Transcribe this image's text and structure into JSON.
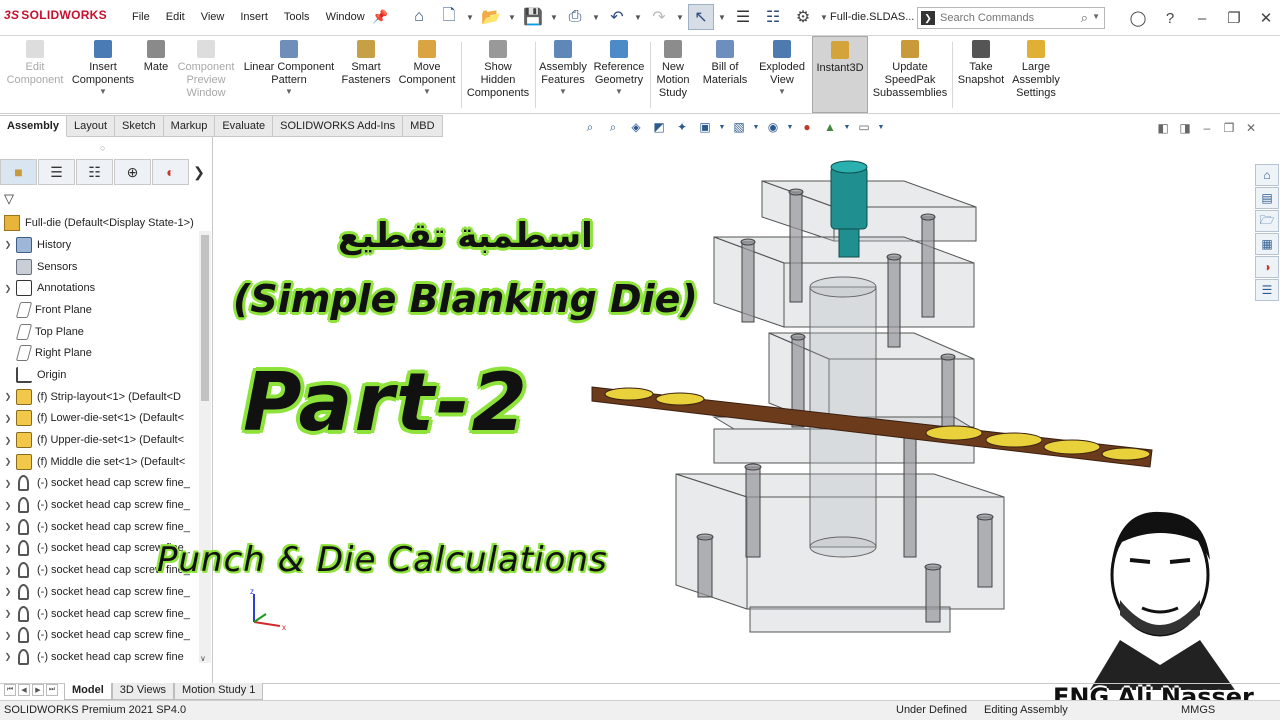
{
  "app": {
    "brand": "SOLIDWORKS",
    "document_title": "Full-die.SLDAS..."
  },
  "menu": [
    "File",
    "Edit",
    "View",
    "Insert",
    "Tools",
    "Window"
  ],
  "search": {
    "placeholder": "Search Commands"
  },
  "ribbon": [
    {
      "label": "Edit\nComponent",
      "enabled": false
    },
    {
      "label": "Insert\nComponents",
      "enabled": true,
      "dropdown": true
    },
    {
      "label": "Mate",
      "enabled": true
    },
    {
      "label": "Component\nPreview\nWindow",
      "enabled": false
    },
    {
      "label": "Linear Component\nPattern",
      "enabled": true,
      "dropdown": true
    },
    {
      "label": "Smart\nFasteners",
      "enabled": true
    },
    {
      "label": "Move\nComponent",
      "enabled": true,
      "dropdown": true
    },
    {
      "label": "Show\nHidden\nComponents",
      "enabled": true
    },
    {
      "label": "Assembly\nFeatures",
      "enabled": true,
      "dropdown": true
    },
    {
      "label": "Reference\nGeometry",
      "enabled": true,
      "dropdown": true
    },
    {
      "label": "New\nMotion\nStudy",
      "enabled": true
    },
    {
      "label": "Bill of\nMaterials",
      "enabled": true
    },
    {
      "label": "Exploded\nView",
      "enabled": true,
      "dropdown": true
    },
    {
      "label": "Instant3D",
      "enabled": true,
      "active": true
    },
    {
      "label": "Update\nSpeedPak\nSubassemblies",
      "enabled": true
    },
    {
      "label": "Take\nSnapshot",
      "enabled": true
    },
    {
      "label": "Large\nAssembly\nSettings",
      "enabled": true
    }
  ],
  "tabs": [
    "Assembly",
    "Layout",
    "Sketch",
    "Markup",
    "Evaluate",
    "SOLIDWORKS Add-Ins",
    "MBD"
  ],
  "active_tab": "Assembly",
  "tree": {
    "root": "Full-die  (Default<Display State-1>)",
    "items": [
      {
        "label": "History",
        "icon": "history-icon",
        "expand": true
      },
      {
        "label": "Sensors",
        "icon": "sensors-icon",
        "expand": false
      },
      {
        "label": "Annotations",
        "icon": "annotations-icon",
        "expand": true
      },
      {
        "label": "Front Plane",
        "icon": "plane-icon",
        "expand": false
      },
      {
        "label": "Top Plane",
        "icon": "plane-icon",
        "expand": false
      },
      {
        "label": "Right Plane",
        "icon": "plane-icon",
        "expand": false
      },
      {
        "label": "Origin",
        "icon": "origin-icon",
        "expand": false
      },
      {
        "label": "(f) Strip-layout<1> (Default<D",
        "icon": "part-icon",
        "expand": true
      },
      {
        "label": "(f) Lower-die-set<1> (Default<",
        "icon": "part-icon",
        "expand": true
      },
      {
        "label": "(f) Upper-die-set<1> (Default<",
        "icon": "part-icon",
        "expand": true
      },
      {
        "label": "(f) Middle die set<1> (Default<",
        "icon": "part-icon",
        "expand": true
      },
      {
        "label": "(-) socket head cap screw fine_",
        "icon": "screw-icon",
        "expand": true
      },
      {
        "label": "(-) socket head cap screw fine_",
        "icon": "screw-icon",
        "expand": true
      },
      {
        "label": "(-) socket head cap screw fine_",
        "icon": "screw-icon",
        "expand": true
      },
      {
        "label": "(-) socket head cap screw fine_",
        "icon": "screw-icon",
        "expand": true
      },
      {
        "label": "(-) socket head cap screw fine_",
        "icon": "screw-icon",
        "expand": true
      },
      {
        "label": "(-) socket head cap screw fine_",
        "icon": "screw-icon",
        "expand": true
      },
      {
        "label": "(-) socket head cap screw fine_",
        "icon": "screw-icon",
        "expand": true
      },
      {
        "label": "(-) socket head cap screw fine_",
        "icon": "screw-icon",
        "expand": true
      },
      {
        "label": "(-) socket head cap screw fine",
        "icon": "screw-icon",
        "expand": true
      }
    ]
  },
  "bottom_tabs": [
    "Model",
    "3D Views",
    "Motion Study 1"
  ],
  "status": {
    "product": "SOLIDWORKS Premium 2021 SP4.0",
    "state": "Under Defined",
    "mode": "Editing Assembly",
    "units": "MMGS"
  },
  "overlay": {
    "arabic_title": "اسطمبة تقطيع",
    "english_title": "(Simple Blanking Die)",
    "part": "Part-2",
    "subtitle": "Punch & Die  Calculations",
    "author": "ENG Ali Nasser"
  },
  "colors": {
    "accent_green": "#8ee33a",
    "brand_red": "#c8102e",
    "punch_teal": "#1f8f8f",
    "strip_brown": "#6b3b1c",
    "strip_yellow": "#e8d13a"
  }
}
